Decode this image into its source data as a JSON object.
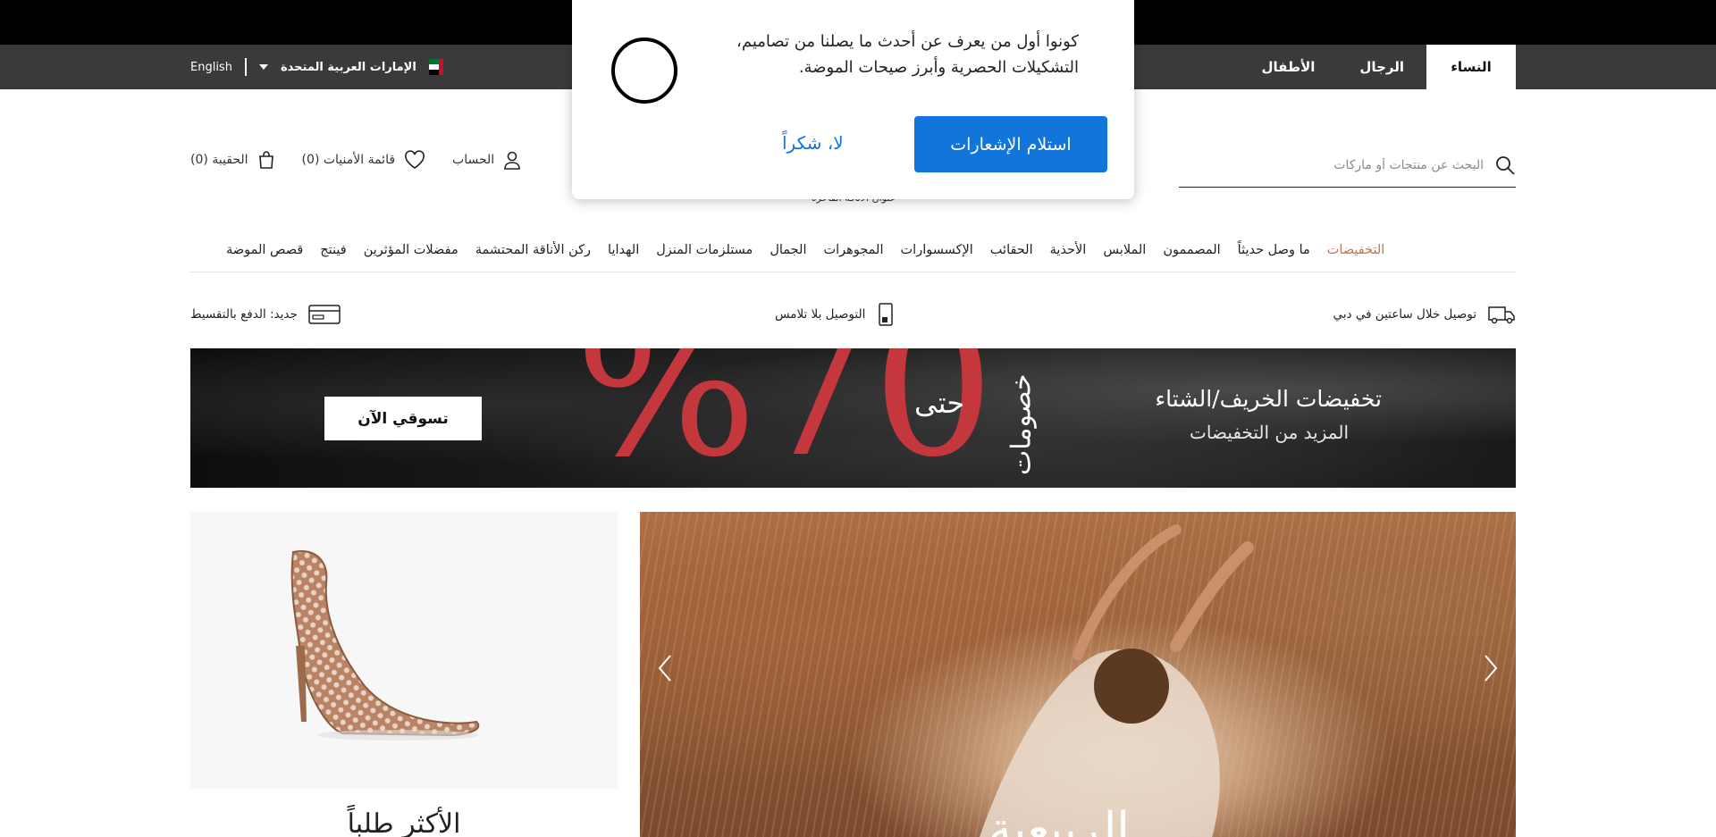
{
  "utility_bar": {
    "language": "English",
    "country": "الإمارات العربية المتحدة",
    "flag_icon": "uae-flag-icon"
  },
  "gender_tabs": [
    {
      "label": "النساء",
      "active": true
    },
    {
      "label": "الرجال",
      "active": false
    },
    {
      "label": "الأطفال",
      "active": false
    }
  ],
  "header": {
    "bag_label": "الحقيبة (0)",
    "wishlist_label": "قائمة الأمنيات (0)",
    "account_label": "الحساب",
    "search_placeholder": "البحث عن منتجات أو ماركات",
    "tagline": "عنوان الأناقة الفاخرة"
  },
  "nav": [
    {
      "label": "التخفيضات",
      "highlight": true
    },
    {
      "label": "ما وصل حديثاً"
    },
    {
      "label": "المصممون"
    },
    {
      "label": "الملابس"
    },
    {
      "label": "الأحذية"
    },
    {
      "label": "الحقائب"
    },
    {
      "label": "الإكسسوارات"
    },
    {
      "label": "المجوهرات"
    },
    {
      "label": "الجمال"
    },
    {
      "label": "مستلزمات المنزل"
    },
    {
      "label": "الهدايا"
    },
    {
      "label": "ركن الأناقة المحتشمة"
    },
    {
      "label": "مفضلات المؤثرين"
    },
    {
      "label": "فينتج"
    },
    {
      "label": "قصص الموضة"
    }
  ],
  "features": {
    "delivery": "توصيل خلال ساعتين في دبي",
    "contactless": "التوصيل بلا تلامس",
    "installments": "جديد: الدفع بالتقسيط"
  },
  "banner": {
    "cta": "تسوقي الآن",
    "discount": "%70",
    "up_to": "حتى",
    "vertical": "خصومات",
    "line1": "تخفيضات الخريف/الشتاء",
    "line2": "المزيد من التخفيضات"
  },
  "promo_left": {
    "title": "الأكثر طلباً"
  },
  "hero": {
    "text": "الربيعية"
  },
  "popup": {
    "message": "كونوا أول من يعرف عن أحدث ما يصلنا من تصاميم، التشكيلات الحصرية وأبرز صيحات الموضة.",
    "accept": "استلام الإشعارات",
    "decline": "لا، شكراً"
  },
  "colors": {
    "sale": "#c4734d",
    "banner_red": "#c4373c",
    "popup_blue": "#1175d9"
  }
}
